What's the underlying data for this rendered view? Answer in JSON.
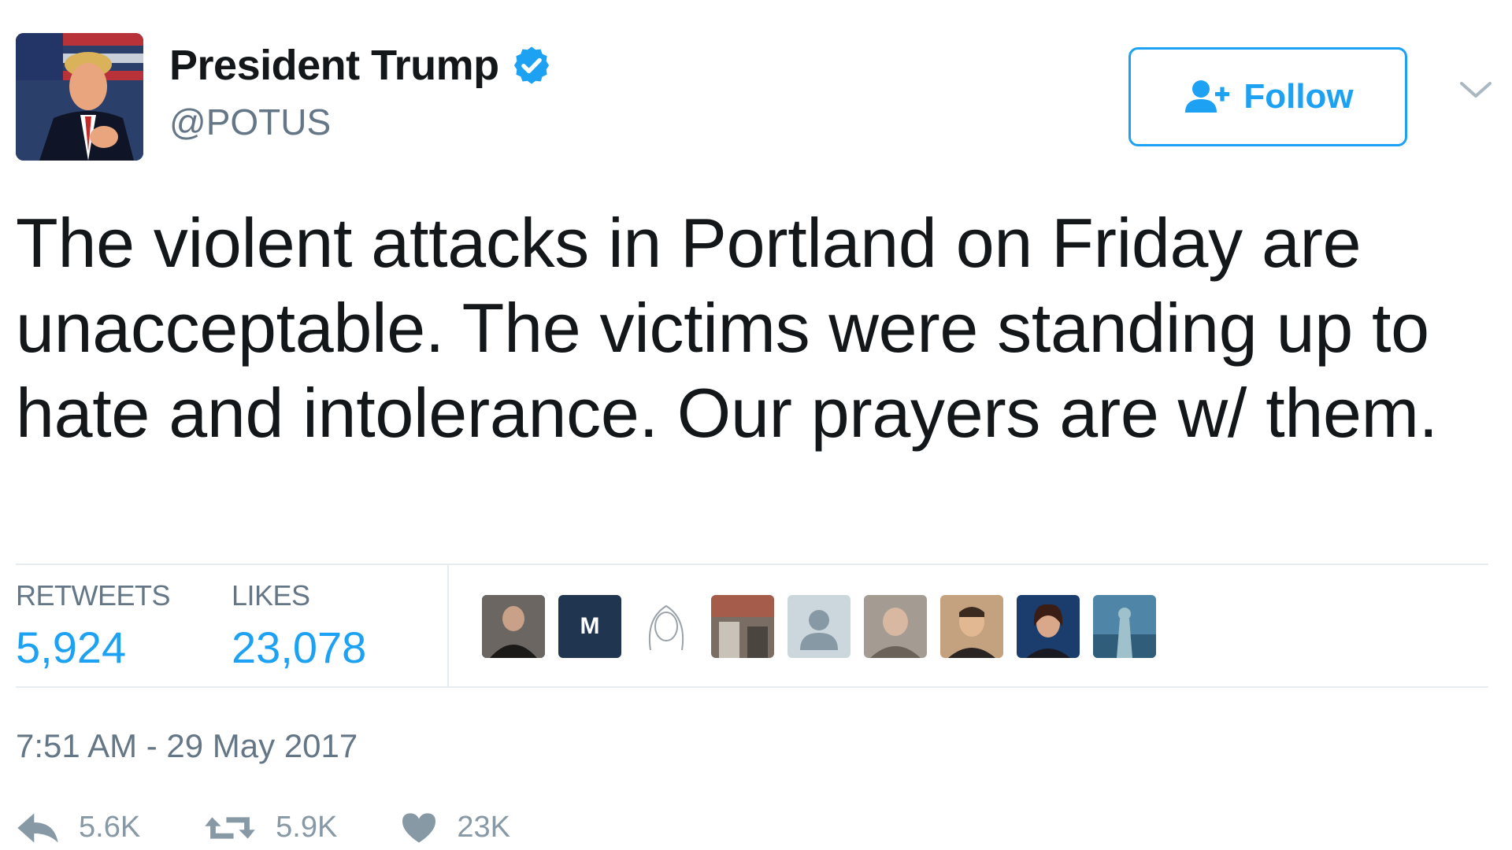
{
  "user": {
    "display_name": "President Trump",
    "handle": "@POTUS",
    "verified": true
  },
  "header": {
    "follow_label": "Follow"
  },
  "tweet": {
    "text": "The violent attacks in Portland on Friday are unacceptable. The victims were standing up to hate and intolerance. Our prayers are w/ them."
  },
  "stats": {
    "retweets_label": "RETWEETS",
    "retweets_count": "5,924",
    "likes_label": "LIKES",
    "likes_count": "23,078"
  },
  "timestamp": "7:51 AM - 29 May 2017",
  "actions": {
    "reply_count": "5.6K",
    "retweet_count": "5.9K",
    "like_count": "23K"
  },
  "likers_letters": {
    "m_avatar": "M"
  },
  "colors": {
    "accent": "#1da1f2",
    "muted": "#657786",
    "action_gray": "#8899a6",
    "text": "#14171a"
  },
  "icons": {
    "verified": "verified-badge-icon",
    "follow": "add-user-icon",
    "menu": "chevron-down-icon",
    "reply": "reply-icon",
    "retweet": "retweet-icon",
    "like": "heart-icon"
  }
}
